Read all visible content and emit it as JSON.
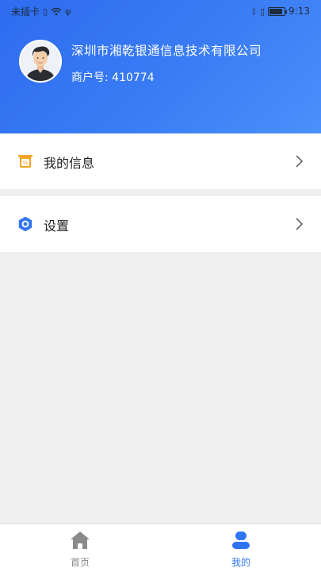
{
  "status_bar": {
    "carrier": "未插卡",
    "time": "9:13"
  },
  "profile": {
    "company_name": "深圳市湘乾银通信息技术有限公司",
    "merchant_id": "商户号: 410774"
  },
  "menu": {
    "items": [
      {
        "label": "我的信息",
        "icon": "coupon-ticket-icon"
      },
      {
        "label": "设置",
        "icon": "settings-hexagon-icon"
      }
    ]
  },
  "bottom_nav": {
    "items": [
      {
        "label": "首页",
        "icon": "home-icon",
        "active": false
      },
      {
        "label": "我的",
        "icon": "user-icon",
        "active": true
      }
    ]
  },
  "colors": {
    "brand_blue": "#2f74f2",
    "header_gradient_start": "#2d6cf0",
    "header_gradient_end": "#4b90fb",
    "info_icon_orange": "#f5a623",
    "inactive_gray": "#8a8a8a"
  }
}
